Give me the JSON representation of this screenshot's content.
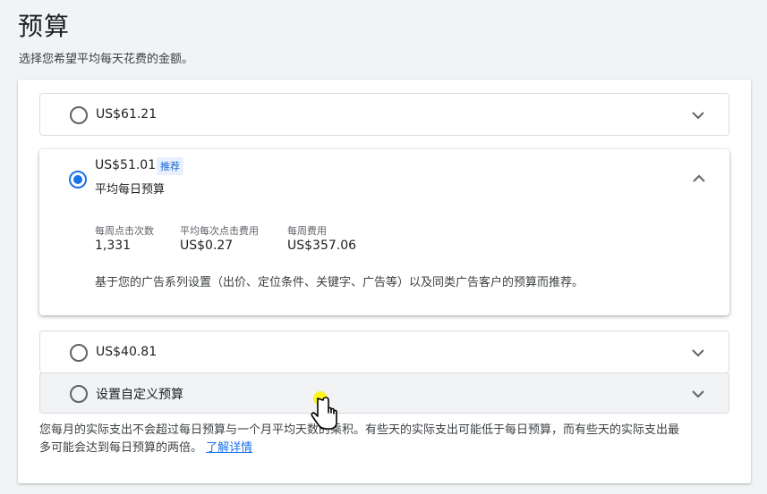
{
  "header": {
    "title": "预算",
    "subtitle": "选择您希望平均每天花费的金额。"
  },
  "options": [
    {
      "label": "US$61.21",
      "selected": false
    },
    {
      "label": "US$51.01",
      "badge": "推荐",
      "sublabel": "平均每日预算",
      "selected": true,
      "stats": [
        {
          "label": "每周点击次数",
          "value": "1,331"
        },
        {
          "label": "平均每次点击费用",
          "value": "US$0.27"
        },
        {
          "label": "每周费用",
          "value": "US$357.06"
        }
      ],
      "explanation": "基于您的广告系列设置（出价、定位条件、关键字、广告等）以及同类广告客户的预算而推荐。"
    },
    {
      "label": "US$40.81",
      "selected": false
    },
    {
      "label": "设置自定义预算",
      "selected": false
    }
  ],
  "footnote": {
    "line1": "您每月的实际支出不会超过每日预算与一个月平均天数的乘积。有些天的实际支出可能低于每日预算，而有些天的实际支出最",
    "line2": "多可能会达到每日预算的两倍。",
    "link": "了解详情"
  },
  "colors": {
    "accent": "#1a73e8",
    "badge_bg": "#e8f0fe",
    "border": "#dadce0"
  },
  "icons": [
    "chevron-down-icon",
    "chevron-up-icon",
    "hand-cursor-icon"
  ]
}
